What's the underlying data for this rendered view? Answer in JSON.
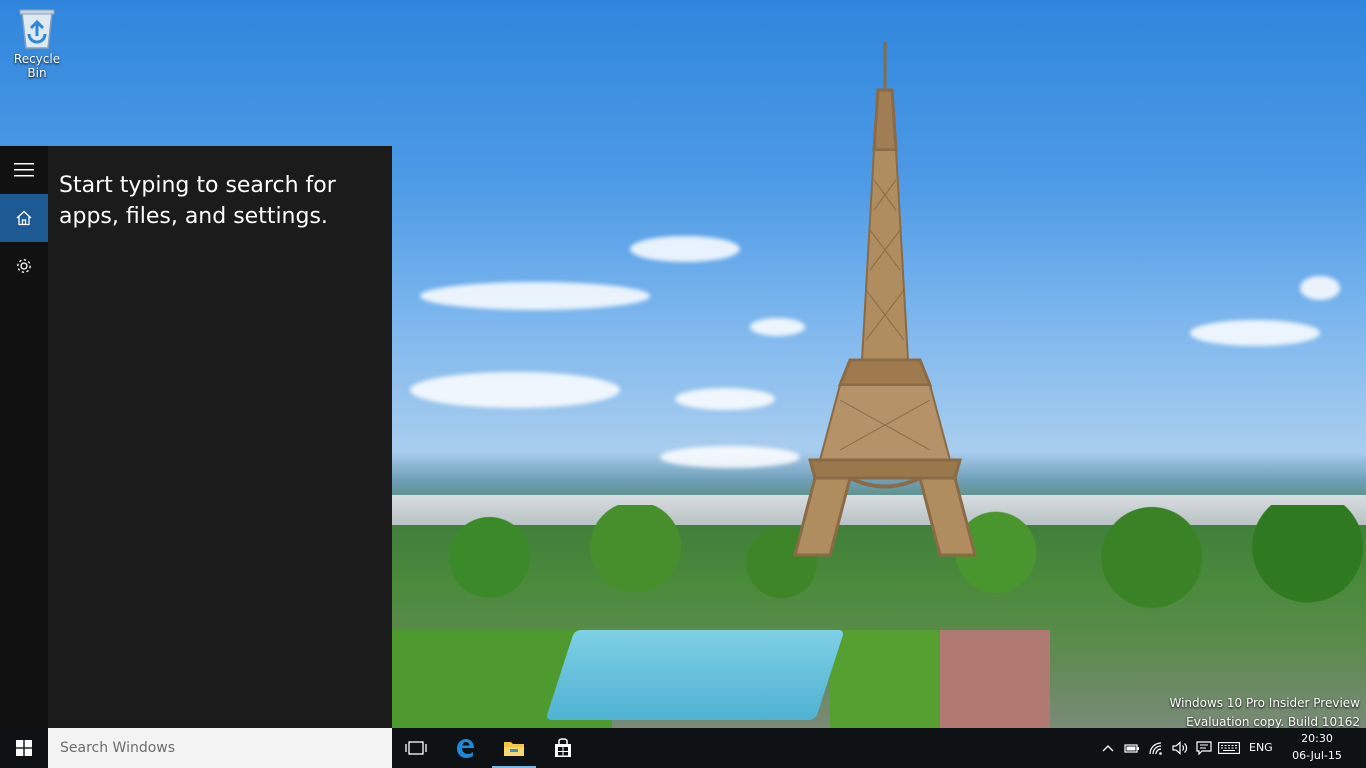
{
  "desktop": {
    "icons": [
      {
        "label": "Recycle Bin",
        "icon": "recycle-bin-icon"
      }
    ],
    "watermark": {
      "line1": "Windows 10 Pro Insider Preview",
      "line2": "Evaluation copy. Build 10162"
    }
  },
  "search_panel": {
    "rail": [
      {
        "icon": "hamburger-menu-icon"
      },
      {
        "icon": "home-icon",
        "active": true
      },
      {
        "icon": "gear-icon"
      }
    ],
    "hint": "Start typing to search for apps, files, and settings."
  },
  "taskbar": {
    "start_icon": "windows-logo-icon",
    "search_placeholder": "Search Windows",
    "apps": [
      {
        "icon": "task-view-icon"
      },
      {
        "icon": "edge-icon"
      },
      {
        "icon": "file-explorer-icon",
        "running": true
      },
      {
        "icon": "store-icon"
      }
    ],
    "tray": {
      "icons": [
        "chevron-up-icon",
        "battery-icon",
        "wifi-icon",
        "volume-icon",
        "action-center-icon",
        "keyboard-icon"
      ],
      "language": "ENG",
      "time": "20:30",
      "date": "06-Jul-15"
    }
  },
  "colors": {
    "accent": "#1d5a94",
    "panel_bg": "#1b1b1b",
    "taskbar_bg": "#0f1215"
  }
}
